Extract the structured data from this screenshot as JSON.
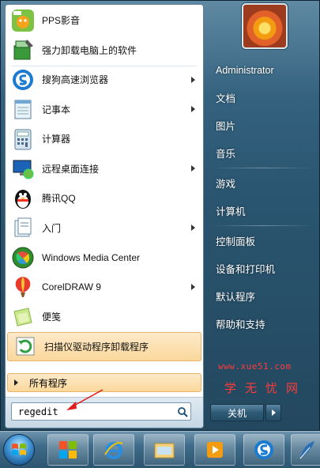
{
  "programs": [
    {
      "label": "PPS影音",
      "icon": "pps-player-icon",
      "submenu": false
    },
    {
      "label": "强力卸载电脑上的软件",
      "icon": "uninstall-tool-icon",
      "submenu": false
    },
    {
      "label": "搜狗高速浏览器",
      "icon": "sogou-browser-icon",
      "submenu": true
    },
    {
      "label": "记事本",
      "icon": "notepad-icon",
      "submenu": true
    },
    {
      "label": "计算器",
      "icon": "calculator-icon",
      "submenu": false
    },
    {
      "label": "远程桌面连接",
      "icon": "remote-desktop-icon",
      "submenu": true
    },
    {
      "label": "腾讯QQ",
      "icon": "qq-penguin-icon",
      "submenu": false
    },
    {
      "label": "入门",
      "icon": "getting-started-icon",
      "submenu": true
    },
    {
      "label": "Windows Media Center",
      "icon": "media-center-icon",
      "submenu": false
    },
    {
      "label": "CorelDRAW 9",
      "icon": "coreldraw-icon",
      "submenu": true
    },
    {
      "label": "便笺",
      "icon": "sticky-notes-icon",
      "submenu": false
    },
    {
      "label": "扫描仪驱动程序卸载程序",
      "icon": "scanner-uninstall-icon",
      "submenu": false
    }
  ],
  "all_programs_label": "所有程序",
  "search": {
    "value": "regedit"
  },
  "right_pane": {
    "user": "Administrator",
    "items": [
      "文档",
      "图片",
      "音乐",
      "游戏",
      "计算机",
      "控制面板",
      "设备和打印机",
      "默认程序",
      "帮助和支持"
    ]
  },
  "watermark": {
    "url": "www.xue51.com",
    "text": "学无忧网"
  },
  "shutdown_label": "关机",
  "colors": {
    "highlight": "#fbd89b",
    "annotation": "#e02020",
    "watermark": "#ff3b3b"
  }
}
